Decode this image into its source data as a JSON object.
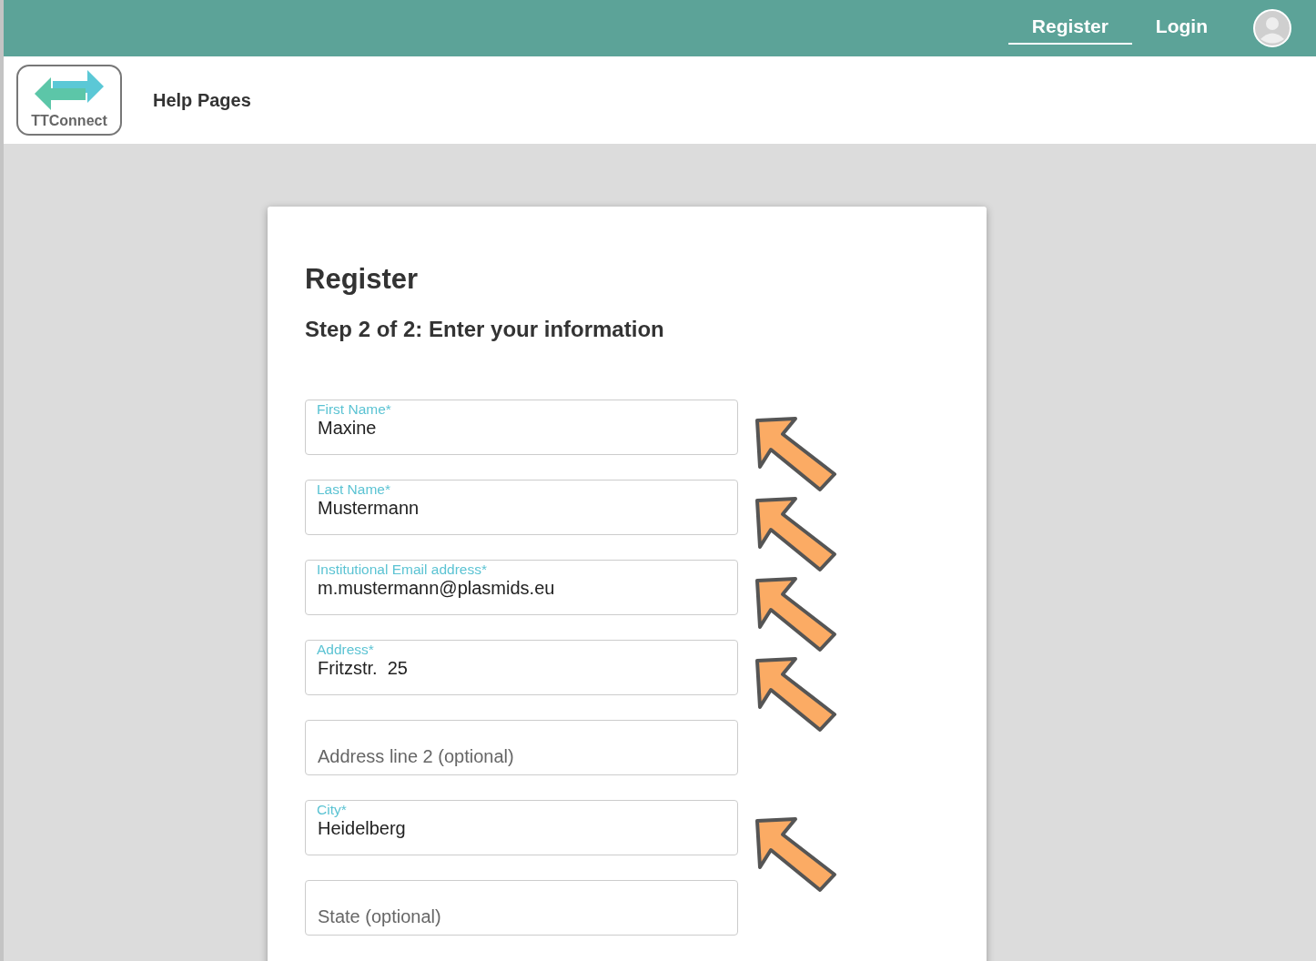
{
  "topbar": {
    "links": [
      {
        "label": "Register",
        "selected": true
      },
      {
        "label": "Login",
        "selected": false
      }
    ]
  },
  "header": {
    "logo_text": "TTConnect",
    "link": "Help Pages"
  },
  "form": {
    "title": "Register",
    "subtitle": "Step 2 of 2: Enter your information",
    "fields": [
      {
        "label": "First Name*",
        "value": "Maxine",
        "annotated": true
      },
      {
        "label": "Last Name*",
        "value": "Mustermann",
        "annotated": true
      },
      {
        "label": "Institutional Email address*",
        "value": "m.mustermann@plasmids.eu",
        "annotated": true
      },
      {
        "label": "Address*",
        "value": "Fritzstr.  25",
        "annotated": true
      },
      {
        "placeholder": "Address line 2 (optional)",
        "annotated": false
      },
      {
        "label": "City*",
        "value": "Heidelberg",
        "annotated": true
      },
      {
        "placeholder": "State (optional)",
        "annotated": false
      }
    ]
  }
}
